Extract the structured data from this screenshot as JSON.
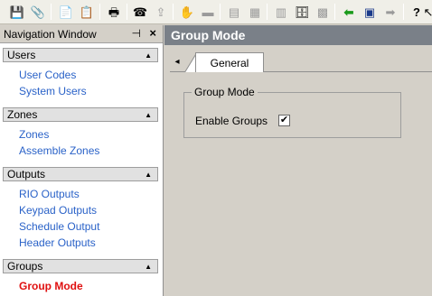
{
  "toolbar": {
    "icons": [
      "save-icon",
      "attach-icon",
      "copy-icon",
      "paste-icon",
      "print-icon",
      "phone-icon",
      "upload-icon",
      "tools-icon",
      "folder-icon",
      "report-icon",
      "chart-icon",
      "export-icon",
      "import-icon",
      "calculator-icon",
      "back-icon",
      "form-icon",
      "forward-icon",
      "help-icon",
      "whats-this-icon"
    ]
  },
  "nav": {
    "title": "Navigation Window",
    "pin": "📌",
    "close": "×",
    "sections": [
      {
        "label": "Users",
        "items": [
          "User Codes",
          "System Users"
        ]
      },
      {
        "label": "Zones",
        "items": [
          "Zones",
          "Assemble Zones"
        ]
      },
      {
        "label": "Outputs",
        "items": [
          "RIO Outputs",
          "Keypad Outputs",
          "Schedule Output",
          "Header Outputs"
        ]
      },
      {
        "label": "Groups",
        "items": [
          "Group Mode"
        ]
      }
    ],
    "active_item": "Group Mode"
  },
  "main": {
    "title": "Group Mode",
    "tab": "General",
    "group": {
      "legend": "Group Mode",
      "enable_label": "Enable Groups",
      "enable_checked": true,
      "check_glyph": "✔"
    }
  },
  "colors": {
    "link": "#2a62c8",
    "active_link": "#e01010",
    "header_bg": "#7a8088"
  }
}
